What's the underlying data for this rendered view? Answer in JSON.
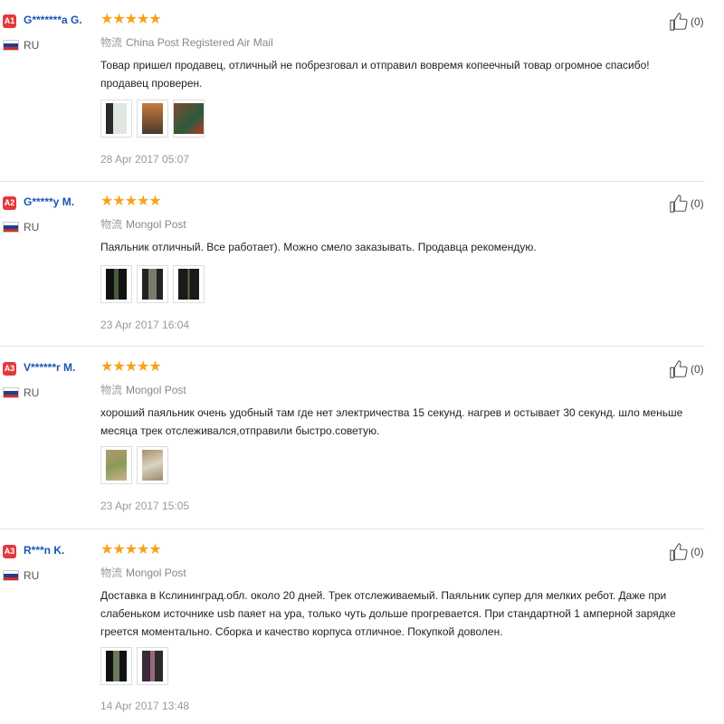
{
  "reviews": [
    {
      "badge": "A1",
      "user": "G*******a G.",
      "country": "RU",
      "stars": "★★★★★",
      "shipping_cn": "物流",
      "shipping": "China Post Registered Air Mail",
      "text": "Товар пришел продавец, отличный не побрезговал и отправил вовремя копеечный товар огромное спасибо! продавец проверен.",
      "date": "28 Apr 2017 05:07",
      "helpful_count": "(0)"
    },
    {
      "badge": "A2",
      "user": "G*****y M.",
      "country": "RU",
      "stars": "★★★★★",
      "shipping_cn": "物流",
      "shipping": "Mongol Post",
      "text": "Паяльник отличный. Все работает). Можно смело заказывать. Продавца рекомендую.",
      "date": "23 Apr 2017 16:04",
      "helpful_count": "(0)"
    },
    {
      "badge": "A3",
      "user": "V******r M.",
      "country": "RU",
      "stars": "★★★★★",
      "shipping_cn": "物流",
      "shipping": "Mongol Post",
      "text": "хороший паяльник очень удобный там где нет электричества 15 секунд. нагрев и остывает 30 секунд. шло меньше месяца трек отслеживался,отправили быстро.советую.",
      "date": "23 Apr 2017 15:05",
      "helpful_count": "(0)"
    },
    {
      "badge": "A3",
      "user": "R***n K.",
      "country": "RU",
      "stars": "★★★★★",
      "shipping_cn": "物流",
      "shipping": "Mongol Post",
      "text": "Доставка в Кслининград.обл. около 20 дней. Трек отслеживаемый. Паяльник супер для мелких ребот. Даже при слабеньком источнике usb паяет на ура, только чуть дольше прогревается. При стандартной 1 амперной зарядке греется моментально. Сборка и качество корпуса отличное. Покупкой доволен.",
      "date": "14 Apr 2017 13:48",
      "helpful_count": "(0)"
    }
  ],
  "colors": {
    "badge": "#e4393c",
    "username": "#1a55b4",
    "stars": "#f9a11b",
    "divider": "#e3e3e3"
  },
  "icons": {
    "helpful": "thumbs-up-icon",
    "country": "russia-flag-icon"
  },
  "rating": {
    "value": 5,
    "max": 5
  }
}
